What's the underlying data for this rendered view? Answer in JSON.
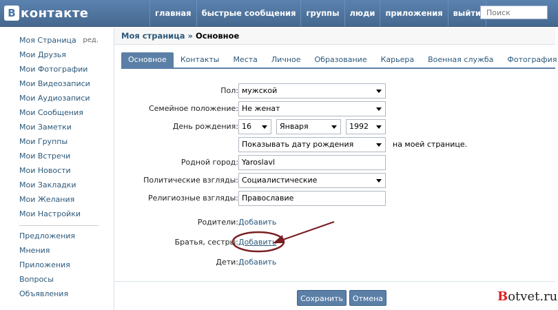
{
  "header": {
    "logo_text": "контакте",
    "logo_mark": "B",
    "nav": [
      "главная",
      "быстрые сообщения",
      "группы",
      "люди",
      "приложения",
      "выйти"
    ],
    "search_placeholder": "Поиск"
  },
  "leftmenu": {
    "items": [
      "Моя Страница",
      "Мои Друзья",
      "Мои Фотографии",
      "Мои Видеозаписи",
      "Мои Аудиозаписи",
      "Мои Сообщения",
      "Мои Заметки",
      "Мои Группы",
      "Мои Встречи",
      "Мои Новости",
      "Мои Закладки",
      "Мои Желания",
      "Мои Настройки"
    ],
    "edit_label": "ред.",
    "extra_items": [
      "Предложения",
      "Мнения",
      "Приложения",
      "Вопросы",
      "Объявления"
    ]
  },
  "breadcrumb": {
    "parent": "Моя страница",
    "separator": "»",
    "current": "Основное"
  },
  "tabs": [
    "Основное",
    "Контакты",
    "Места",
    "Личное",
    "Образование",
    "Карьера",
    "Военная служба",
    "Фотография"
  ],
  "form": {
    "gender": {
      "label": "Пол:",
      "value": "мужской"
    },
    "marital": {
      "label": "Семейное положение:",
      "value": "Не женат"
    },
    "birthday": {
      "label": "День рождения:",
      "day": "16",
      "month": "Января",
      "year": "1992"
    },
    "birthday_display": {
      "value": "Показывать дату рождения",
      "note": "на моей странице."
    },
    "hometown": {
      "label": "Родной город:",
      "value": "Yaroslavl"
    },
    "political": {
      "label": "Политические взгляды:",
      "value": "Социалистические"
    },
    "religious": {
      "label": "Религиозные взгляды:",
      "value": "Православие"
    },
    "parents": {
      "label": "Родители:",
      "link": "Добавить"
    },
    "siblings": {
      "label": "Братья, сестры:",
      "link": "Добавить"
    },
    "children": {
      "label": "Дети:",
      "link": "Добавить"
    }
  },
  "buttons": {
    "save": "Сохранить",
    "cancel": "Отмена"
  },
  "watermark": {
    "b": "B",
    "rest": "otvet.ru"
  },
  "colors": {
    "header": "#4a76a8",
    "accent": "#5b7fa6",
    "link": "#2b587a",
    "annotation": "#7a1e22"
  }
}
